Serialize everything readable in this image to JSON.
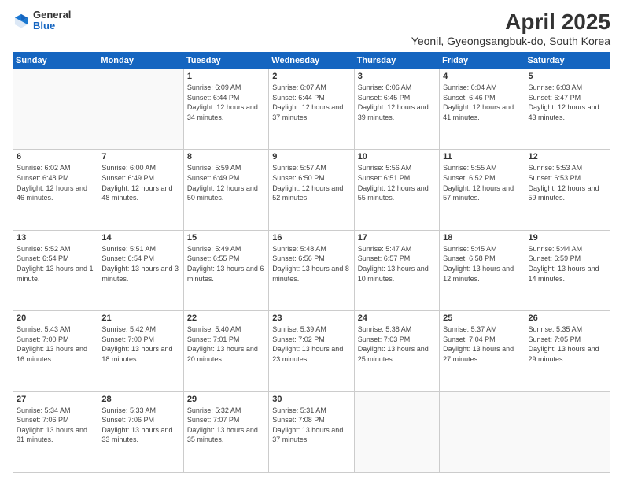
{
  "logo": {
    "general": "General",
    "blue": "Blue"
  },
  "title": "April 2025",
  "subtitle": "Yeonil, Gyeongsangbuk-do, South Korea",
  "days_header": [
    "Sunday",
    "Monday",
    "Tuesday",
    "Wednesday",
    "Thursday",
    "Friday",
    "Saturday"
  ],
  "weeks": [
    [
      {
        "num": "",
        "info": ""
      },
      {
        "num": "",
        "info": ""
      },
      {
        "num": "1",
        "info": "Sunrise: 6:09 AM\nSunset: 6:44 PM\nDaylight: 12 hours and 34 minutes."
      },
      {
        "num": "2",
        "info": "Sunrise: 6:07 AM\nSunset: 6:44 PM\nDaylight: 12 hours and 37 minutes."
      },
      {
        "num": "3",
        "info": "Sunrise: 6:06 AM\nSunset: 6:45 PM\nDaylight: 12 hours and 39 minutes."
      },
      {
        "num": "4",
        "info": "Sunrise: 6:04 AM\nSunset: 6:46 PM\nDaylight: 12 hours and 41 minutes."
      },
      {
        "num": "5",
        "info": "Sunrise: 6:03 AM\nSunset: 6:47 PM\nDaylight: 12 hours and 43 minutes."
      }
    ],
    [
      {
        "num": "6",
        "info": "Sunrise: 6:02 AM\nSunset: 6:48 PM\nDaylight: 12 hours and 46 minutes."
      },
      {
        "num": "7",
        "info": "Sunrise: 6:00 AM\nSunset: 6:49 PM\nDaylight: 12 hours and 48 minutes."
      },
      {
        "num": "8",
        "info": "Sunrise: 5:59 AM\nSunset: 6:49 PM\nDaylight: 12 hours and 50 minutes."
      },
      {
        "num": "9",
        "info": "Sunrise: 5:57 AM\nSunset: 6:50 PM\nDaylight: 12 hours and 52 minutes."
      },
      {
        "num": "10",
        "info": "Sunrise: 5:56 AM\nSunset: 6:51 PM\nDaylight: 12 hours and 55 minutes."
      },
      {
        "num": "11",
        "info": "Sunrise: 5:55 AM\nSunset: 6:52 PM\nDaylight: 12 hours and 57 minutes."
      },
      {
        "num": "12",
        "info": "Sunrise: 5:53 AM\nSunset: 6:53 PM\nDaylight: 12 hours and 59 minutes."
      }
    ],
    [
      {
        "num": "13",
        "info": "Sunrise: 5:52 AM\nSunset: 6:54 PM\nDaylight: 13 hours and 1 minute."
      },
      {
        "num": "14",
        "info": "Sunrise: 5:51 AM\nSunset: 6:54 PM\nDaylight: 13 hours and 3 minutes."
      },
      {
        "num": "15",
        "info": "Sunrise: 5:49 AM\nSunset: 6:55 PM\nDaylight: 13 hours and 6 minutes."
      },
      {
        "num": "16",
        "info": "Sunrise: 5:48 AM\nSunset: 6:56 PM\nDaylight: 13 hours and 8 minutes."
      },
      {
        "num": "17",
        "info": "Sunrise: 5:47 AM\nSunset: 6:57 PM\nDaylight: 13 hours and 10 minutes."
      },
      {
        "num": "18",
        "info": "Sunrise: 5:45 AM\nSunset: 6:58 PM\nDaylight: 13 hours and 12 minutes."
      },
      {
        "num": "19",
        "info": "Sunrise: 5:44 AM\nSunset: 6:59 PM\nDaylight: 13 hours and 14 minutes."
      }
    ],
    [
      {
        "num": "20",
        "info": "Sunrise: 5:43 AM\nSunset: 7:00 PM\nDaylight: 13 hours and 16 minutes."
      },
      {
        "num": "21",
        "info": "Sunrise: 5:42 AM\nSunset: 7:00 PM\nDaylight: 13 hours and 18 minutes."
      },
      {
        "num": "22",
        "info": "Sunrise: 5:40 AM\nSunset: 7:01 PM\nDaylight: 13 hours and 20 minutes."
      },
      {
        "num": "23",
        "info": "Sunrise: 5:39 AM\nSunset: 7:02 PM\nDaylight: 13 hours and 23 minutes."
      },
      {
        "num": "24",
        "info": "Sunrise: 5:38 AM\nSunset: 7:03 PM\nDaylight: 13 hours and 25 minutes."
      },
      {
        "num": "25",
        "info": "Sunrise: 5:37 AM\nSunset: 7:04 PM\nDaylight: 13 hours and 27 minutes."
      },
      {
        "num": "26",
        "info": "Sunrise: 5:35 AM\nSunset: 7:05 PM\nDaylight: 13 hours and 29 minutes."
      }
    ],
    [
      {
        "num": "27",
        "info": "Sunrise: 5:34 AM\nSunset: 7:06 PM\nDaylight: 13 hours and 31 minutes."
      },
      {
        "num": "28",
        "info": "Sunrise: 5:33 AM\nSunset: 7:06 PM\nDaylight: 13 hours and 33 minutes."
      },
      {
        "num": "29",
        "info": "Sunrise: 5:32 AM\nSunset: 7:07 PM\nDaylight: 13 hours and 35 minutes."
      },
      {
        "num": "30",
        "info": "Sunrise: 5:31 AM\nSunset: 7:08 PM\nDaylight: 13 hours and 37 minutes."
      },
      {
        "num": "",
        "info": ""
      },
      {
        "num": "",
        "info": ""
      },
      {
        "num": "",
        "info": ""
      }
    ]
  ]
}
